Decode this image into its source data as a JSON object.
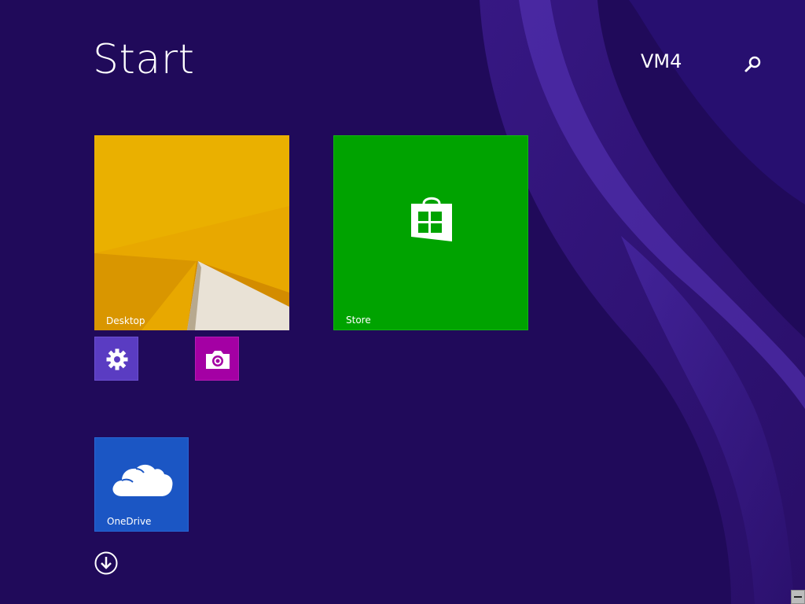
{
  "header": {
    "title": "Start",
    "user_name": "VM4",
    "search_icon": "search-icon"
  },
  "colors": {
    "background": "#200a5a",
    "desktop_tile": "#e8a800",
    "store_tile": "#00a300",
    "settings_tile": "#5a3cc2",
    "camera_tile": "#a400a4",
    "onedrive_tile": "#1b56c4"
  },
  "tiles": {
    "desktop": {
      "label": "Desktop"
    },
    "store": {
      "label": "Store",
      "icon": "store-bag-icon"
    },
    "settings": {
      "icon": "gear-icon"
    },
    "camera": {
      "icon": "camera-icon"
    },
    "onedrive": {
      "label": "OneDrive",
      "icon": "cloud-icon"
    }
  },
  "footer": {
    "all_apps_icon": "down-arrow-circle-icon"
  }
}
